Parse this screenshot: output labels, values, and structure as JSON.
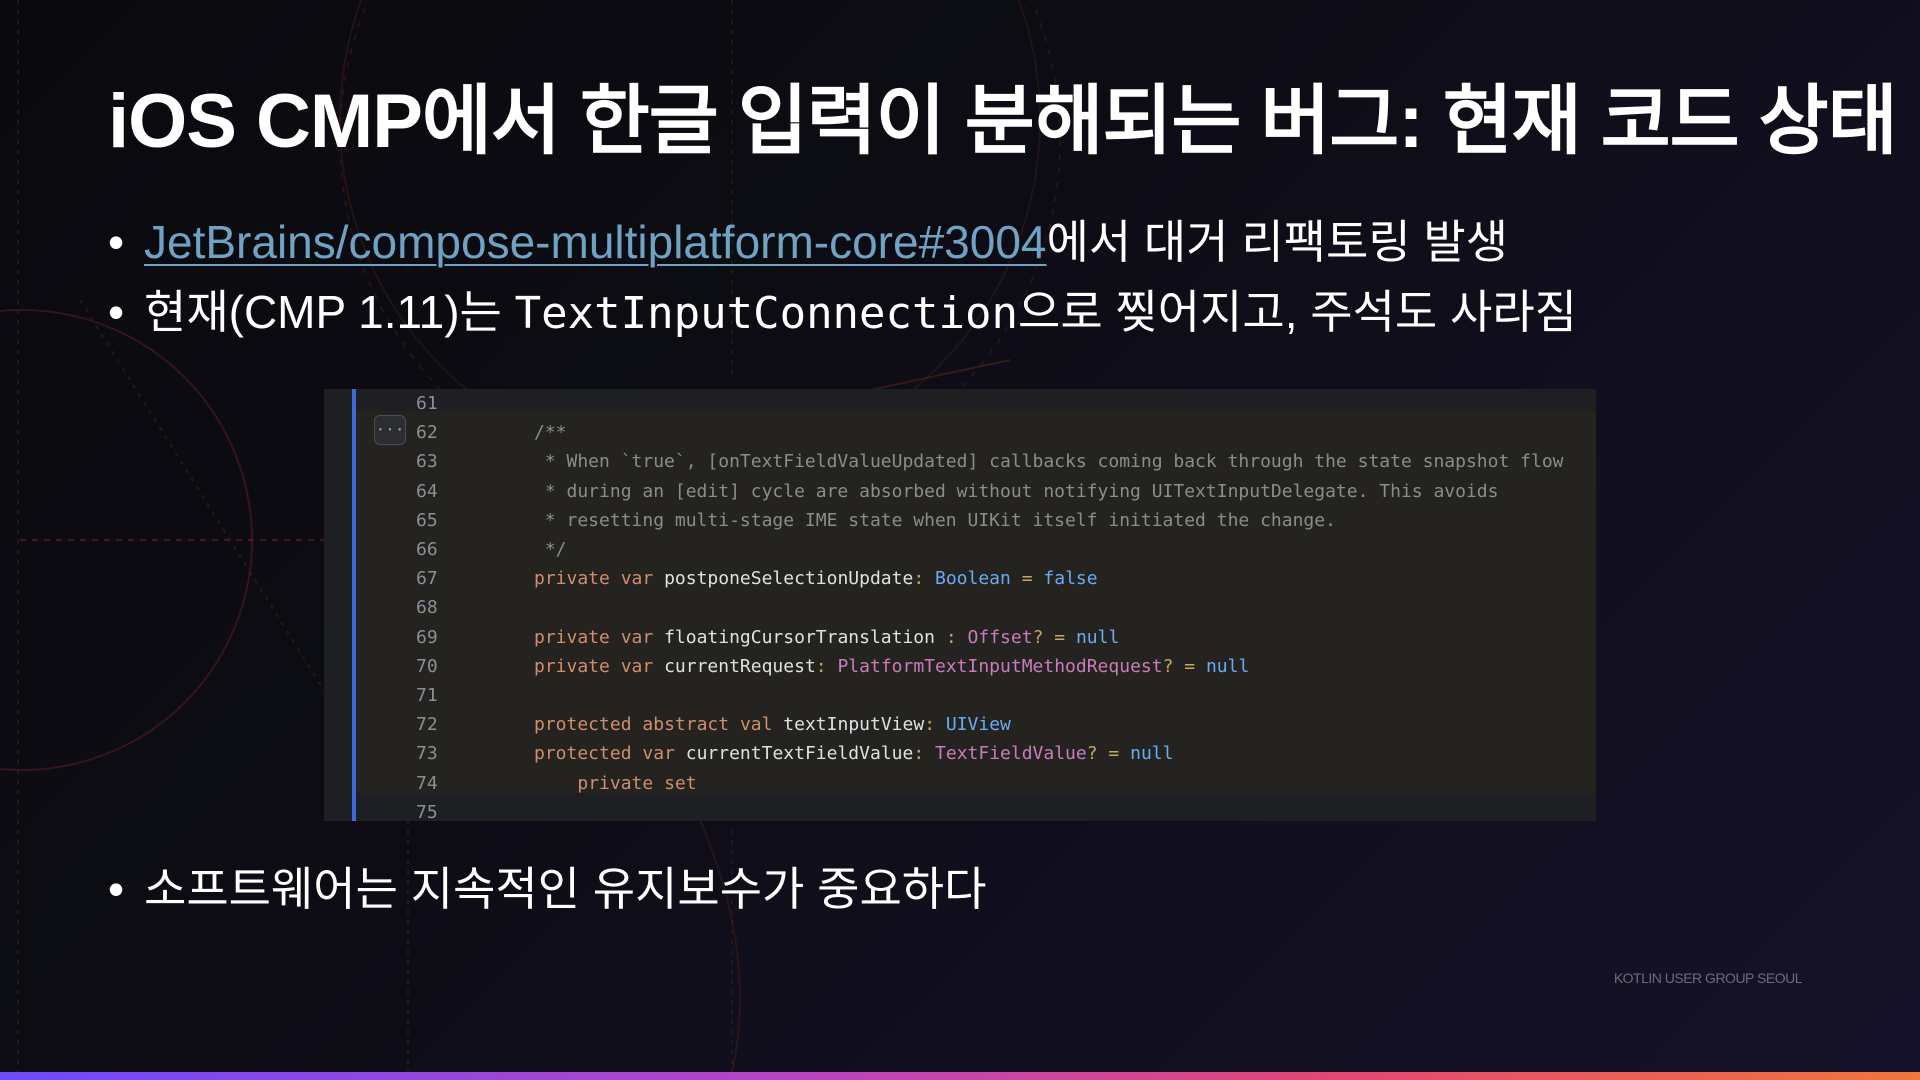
{
  "slide": {
    "title": "iOS CMP에서 한글 입력이 분해되는 버그: 현재 코드 상태",
    "bullets": [
      {
        "link_text": "JetBrains/compose-multiplatform-core#3004",
        "suffix": "에서 대거 리팩토링 발생"
      },
      {
        "prefix": "현재(CMP 1.11)는 ",
        "code": "TextInputConnection",
        "suffix": "으로 찢어지고, 주석도 사라짐"
      },
      {
        "text": "소프트웨어는 지속적인 유지보수가 중요하다"
      }
    ],
    "bullet_symbol": "•",
    "footer": "KOTLIN USER GROUP SEOUL"
  },
  "code_panel": {
    "fold_label": "···",
    "lines": [
      {
        "n": "61",
        "src": ""
      },
      {
        "n": "62",
        "src": "/**"
      },
      {
        "n": "63",
        "src": " * When `true`, [onTextFieldValueUpdated] callbacks coming back through the state snapshot flow"
      },
      {
        "n": "64",
        "src": " * during an [edit] cycle are absorbed without notifying UITextInputDelegate. This avoids"
      },
      {
        "n": "65",
        "src": " * resetting multi-stage IME state when UIKit itself initiated the change."
      },
      {
        "n": "66",
        "src": " */"
      },
      {
        "n": "67",
        "src": "private var postponeSelectionUpdate: Boolean = false"
      },
      {
        "n": "68",
        "src": ""
      },
      {
        "n": "69",
        "src": "private var floatingCursorTranslation : Offset? = null"
      },
      {
        "n": "70",
        "src": "private var currentRequest: PlatformTextInputMethodRequest? = null"
      },
      {
        "n": "71",
        "src": ""
      },
      {
        "n": "72",
        "src": "protected abstract val textInputView: UIView"
      },
      {
        "n": "73",
        "src": "protected var currentTextFieldValue: TextFieldValue? = null"
      },
      {
        "n": "74",
        "src": "    private set"
      },
      {
        "n": "75",
        "src": ""
      }
    ]
  },
  "colors": {
    "link": "#6fa3c4",
    "gutter_accent": "#3c6bd8",
    "keyword": "#cf8e6d",
    "type": "#6aabf7",
    "purple_type": "#c77dbb",
    "comment": "#8c8c8c"
  }
}
